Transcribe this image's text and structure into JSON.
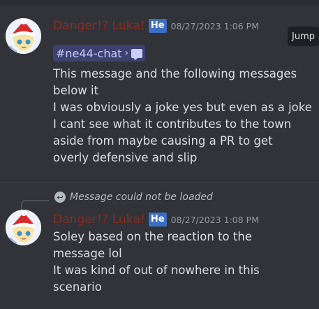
{
  "message1": {
    "username": "Danger!? Luka!",
    "badge": "He",
    "timestamp": "08/27/2023 1:06 PM",
    "jump_label": "Jump",
    "channel": "#ne44-chat",
    "channel_chevron": "›",
    "lines": [
      "This message and the following messages",
      "below it",
      "I was obviously a joke yes but even as a joke",
      "I cant see what it contributes to the town",
      "aside from maybe causing a PR to get",
      "overly defensive and slip"
    ]
  },
  "message2": {
    "reply_text": "Message could not be loaded",
    "username": "Danger!? Luka!",
    "badge": "He",
    "timestamp": "08/27/2023 1:08 PM",
    "lines": [
      "Soley based on the reaction to the",
      "message lol",
      "It was kind of out of nowhere in this",
      "scenario"
    ]
  },
  "colors": {
    "background": "#313338",
    "username": "#8a2c1e",
    "badge": "#3b6fc4",
    "channel_chip": "#3c4270"
  },
  "icons": {
    "reply": "reply-arrow-icon",
    "thread": "thread-icon"
  }
}
